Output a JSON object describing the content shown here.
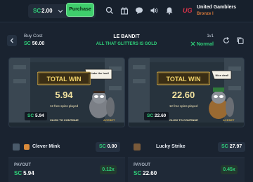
{
  "topbar": {
    "currency": "SC",
    "balance": "2.00",
    "purchase_label": "Purchase",
    "team_name": "United Gamblers",
    "team_rank": "Bronze I",
    "logo_text": "UG",
    "icons": [
      "search-icon",
      "gift-icon",
      "chat-icon",
      "sound-icon",
      "bell-icon"
    ]
  },
  "header": {
    "buy_cost_label": "Buy Cost",
    "buy_cost_currency": "SC",
    "buy_cost_value": "50.00",
    "game_title": "LE BANDIT",
    "game_subtitle": "ALL THAT GLITTERS IS GOLD",
    "mode": "1v1",
    "volatility": "Normal"
  },
  "panels": [
    {
      "banner_text": "TOTAL WIN",
      "win_value": "5.94",
      "spins_text": "12 free spins played",
      "click_text": "CLICK TO CONTINUE",
      "brand": "ACEBET",
      "bubble": "I'll take the loot!",
      "badge_currency": "SC",
      "badge_value": "5.94"
    },
    {
      "banner_text": "TOTAL WIN",
      "win_value": "22.60",
      "spins_text": "12 free spins played",
      "click_text": "CLICK TO CONTINUE",
      "brand": "ACEBET",
      "bubble": "Nice deal!",
      "badge_currency": "SC",
      "badge_value": "22.60"
    }
  ],
  "players": [
    {
      "name": "Clever Mink",
      "balance_currency": "SC",
      "balance": "0.00",
      "payout_label": "PAYOUT",
      "payout_currency": "SC",
      "payout": "5.94",
      "multiplier": "0.12x"
    },
    {
      "name": "Lucky Strike",
      "balance_currency": "SC",
      "balance": "27.97",
      "payout_label": "PAYOUT",
      "payout_currency": "SC",
      "payout": "22.60",
      "multiplier": "0.45x"
    }
  ],
  "colors": {
    "accent_green": "#2fd27a",
    "background": "#1a2330",
    "brand_red": "#e0344b"
  }
}
